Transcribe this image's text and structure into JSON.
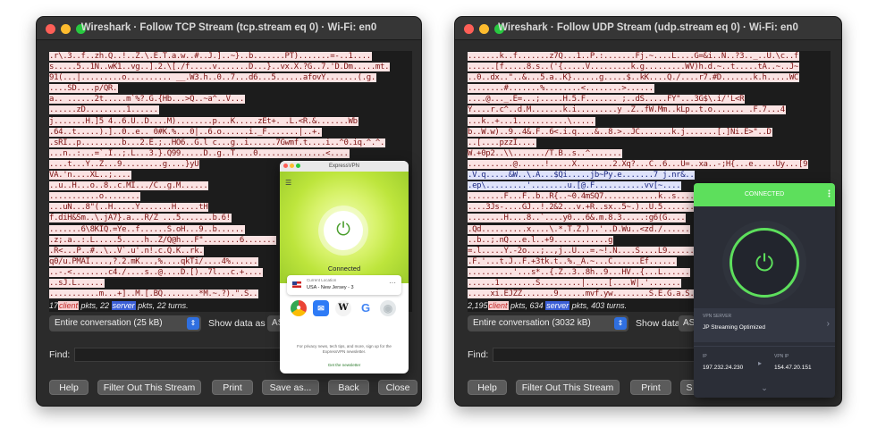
{
  "tcp_window": {
    "title": "Wireshark · Follow TCP Stream (tcp.stream eq 0) · Wi-Fi: en0",
    "stream_lines": [
      {
        "kind": "client",
        "text": ".r\\.3..f..zh.Q..!..Z.\\.E.T.a.w..#..J.]..~}..b.......PT).......=-..1...."
      },
      {
        "kind": "client",
        "text": "s.....5..1N..wK1..vg..].2.\\[./f.....v.......D...}..vx.X.?G..7.'D.Dm.....mt."
      },
      {
        "kind": "client",
        "text": "91(...|.........o.......... __.W3.h..0..7...d6...5......afovY.......(.g."
      },
      {
        "kind": "client",
        "text": "....SD....p/QR."
      },
      {
        "kind": "client",
        "text": "a.. ......2t.....m`%?.G.{Hb...>Q..~a^..V..."
      },
      {
        "kind": "client",
        "text": "......zD.........1......"
      },
      {
        "kind": "client",
        "text": "j.......H.]5 4..6.U..D....M)........p...K.....zEt+.  .L.<R.&.......Wb"
      },
      {
        "kind": "client",
        "text": ".64..t.....).]..0..e..            0#K.%...0|..6.o......i._F.......|..+."
      },
      {
        "kind": "client",
        "text": ".sRI..p.........b...2.E.;..HO6..G.l c...g..i......7Gwmf.t....i..^0.iq.^.^."
      },
      {
        "kind": "client",
        "text": "...n..:...=`.I..;.L...3.}.Q99.....D..g..T....0...............<...."
      },
      {
        "kind": "client",
        "text": "....t...Y..Z...9.........g....}yU"
      },
      {
        "kind": "client",
        "text": "VA.'n....XL..;...."
      },
      {
        "kind": "client",
        "text": "..u..H...o..8..c.MI.../C..g.M......"
      },
      {
        "kind": "client",
        "text": "...........o........"
      },
      {
        "kind": "client",
        "text": "...uN...8\"(..H.....Y.......H.....tH"
      },
      {
        "kind": "client",
        "text": "f.diH&Sm..\\.jA7}.a...R/Z        ...5.......b.6!"
      },
      {
        "kind": "client",
        "text": ".......6\\8KIQ.=Ye..f......S.oH...9..b......"
      },
      {
        "kind": "client",
        "text": ".z;.a..:.L.....5.....h..Z/Q@h...F\"........6......."
      },
      {
        "kind": "client",
        "text": ".R<...P..#..\\..V`.u'.n!.c.Q.K..rk."
      },
      {
        "kind": "client",
        "text": "q0/u.PMAI....,?.2.mK...,%....qkTi/....4%......"
      },
      {
        "kind": "client",
        "text": "..-.<........c4./....s..@....D.[)..7l...c.+...."
      },
      {
        "kind": "client",
        "text": "..sJ.L......"
      },
      {
        "kind": "client",
        "text": "...........m...+]..M.[.BQ........*M.~.?).\".S.."
      }
    ],
    "summary": {
      "client_count": "17",
      "client_word": "client",
      "mid": " pkts, 22 ",
      "server_word": "server",
      "tail": " pkts, 22 turns."
    },
    "conversation_select": "Entire conversation (25 kB)",
    "show_data_label": "Show data as",
    "show_data_value": "ASCII",
    "find_label": "Find:",
    "buttons": {
      "help": "Help",
      "filter": "Filter Out This Stream",
      "print": "Print",
      "save": "Save as...",
      "back": "Back",
      "close": "Close"
    }
  },
  "udp_window": {
    "title": "Wireshark · Follow UDP Stream (udp.stream eq 0) · Wi-Fi: en0",
    "stream_lines": [
      {
        "kind": "client",
        "text": ".......k..f.......z7Q...1..P.:.......Fj.~....L....G=&i..N..?3.._..U.\\c..f"
      },
      {
        "kind": "client",
        "text": "......[f.....8.s..('{.....V.........k.g.........WV)h.d.~..t.....tA..~..J~"
      },
      {
        "kind": "client",
        "text": "..0..dx..\"..&...5.a..K}......g.....$..kK....Q./....r7.#D.......k.h.....WC"
      },
      {
        "kind": "client",
        "text": "........#.......%........<........>......"
      },
      {
        "kind": "client",
        "text": "....@..._.E=...;.....H.5.F.......     ;..dS.....FY\"...3G$\\.i/'L<R"
      },
      {
        "kind": "client",
        "text": "Y....r.c^..d.M.......k.i.........y .Z..fW.Mm..kLp..t.o.......   .F.7...4"
      },
      {
        "kind": "client",
        "text": "...k..+...1...........\\....."
      },
      {
        "kind": "client",
        "text": "b..W.w)..9..4&.F..6<.i.q....&..8.>..JC.......k.j.......[.]Ni.E>\"..D"
      },
      {
        "kind": "client",
        "text": "..[....pzzI...."
      },
      {
        "kind": "client",
        "text": "W.+0p2..\\\\......./T.B..s..^......."
      },
      {
        "kind": "client",
        "text": "..........@......!.....X........2.Xq?...C..6...U=..xa..-;H{...e.....Uy...[9"
      },
      {
        "kind": "server",
        "text": ".V.q.....&W..\\.A...$Qi.....jb~Py.e.......7   j.nr&.."
      },
      {
        "kind": "server",
        "text": ".ep\\.........'........u.[@.F...........vv[~...."
      },
      {
        "kind": "client",
        "text": "........F...F..b..R{..~0.4mSQ7............k..s...."
      },
      {
        "kind": "client",
        "text": "....3Js-....GJ..!.2&2...v.+R..sx..5~.)..U.5........."
      },
      {
        "kind": "client",
        "text": "........H....8..`....y0...6&.m.8.3.....:g6(G...."
      },
      {
        "kind": "client",
        "text": ".Qd..........x....\\.*.T.Z.)..'..D.Wu..<zd./......"
      },
      {
        "kind": "client",
        "text": "..b..;.nQ...e.l..+9............g"
      },
      {
        "kind": "client",
        "text": "=.l.....Y.-2o...;..,j..U...=.~!.N....S....L9......"
      },
      {
        "kind": "client",
        "text": ".F.'...t.J..F.+3tk.t..%._A.~...C......Ef......"
      },
      {
        "kind": "client",
        "text": "..........'...s*..{.Z..3..8h..9...HV..{...L......"
      },
      {
        "kind": "client",
        "text": "......1........S.........|.....[....W|.'......."
      },
      {
        "kind": "client",
        "text": ".....xi.EJZZ.......9......mvf.yw........S.E.G.a.S.c......."
      }
    ],
    "summary": {
      "client_count": "2,195",
      "client_word": "client",
      "mid": " pkts, 634 ",
      "server_word": "server",
      "tail": " pkts, 403 turns."
    },
    "conversation_select": "Entire conversation (3032 kB)",
    "show_data_label": "Show data as",
    "show_data_value": "ASCII",
    "find_label": "Find:",
    "buttons": {
      "help": "Help",
      "filter": "Filter Out This Stream",
      "print": "Print"
    }
  },
  "expressvpn": {
    "title": "ExpressVPN",
    "status": "Connected",
    "location_label": "Current Location",
    "location_value": "USA - New Jersey - 3",
    "footer": "For privacy news, tech tips, and more, sign up for the ExpressVPN newsletter.",
    "link": "Get the newsletter",
    "accent": "#c5ea45"
  },
  "pia": {
    "status": "CONNECTED",
    "server_label": "VPN SERVER",
    "server_value": "JP Streaming Optimized",
    "ip_label": "IP",
    "ip_value": "197.232.24.230",
    "vpn_ip_label": "VPN IP",
    "vpn_ip_value": "154.47.20.151",
    "accent": "#5ddf5c"
  }
}
